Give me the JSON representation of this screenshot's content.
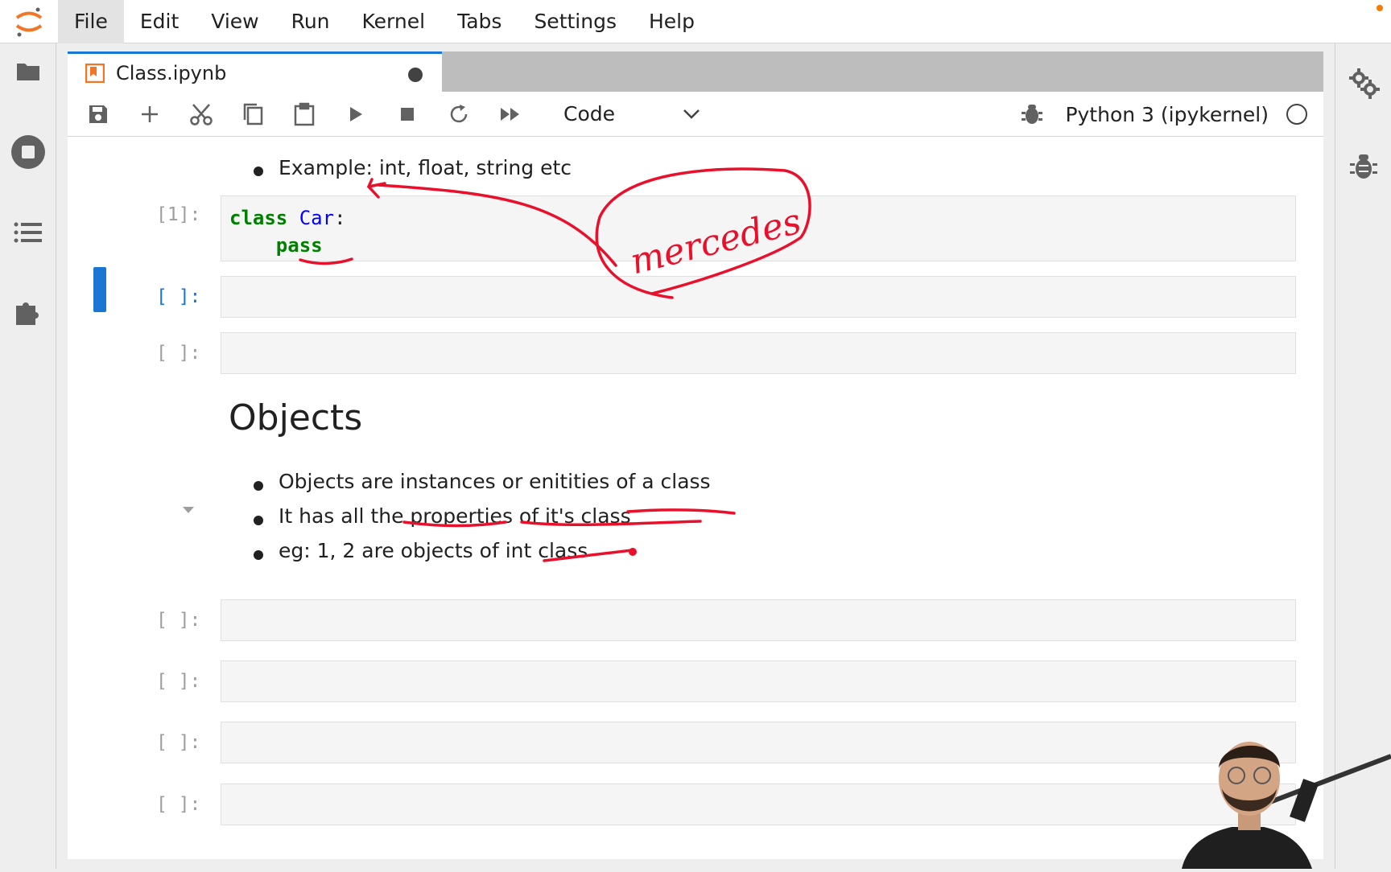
{
  "menubar": {
    "items": [
      "File",
      "Edit",
      "View",
      "Run",
      "Kernel",
      "Tabs",
      "Settings",
      "Help"
    ]
  },
  "tab": {
    "label": "Class.ipynb"
  },
  "toolbar": {
    "cell_type": "Code",
    "kernel_name": "Python 3 (ipykernel)"
  },
  "notebook": {
    "top_bullet": "Example: int, float, string etc",
    "cells": [
      {
        "prompt": "[1]:",
        "code_line1_kw": "class",
        "code_line1_name": "Car",
        "code_line1_colon": ":",
        "code_line2_kw": "pass"
      },
      {
        "prompt": "[ ]:"
      },
      {
        "prompt": "[ ]:"
      },
      {
        "prompt": "[ ]:"
      },
      {
        "prompt": "[ ]:"
      },
      {
        "prompt": "[ ]:"
      },
      {
        "prompt": "[ ]:"
      }
    ],
    "heading": "Objects",
    "bullets": [
      "Objects are instances or enitities of a class",
      "It has all the properties of it's class",
      "eg: 1, 2 are objects of int class"
    ]
  },
  "annotation": {
    "handwritten": "mercedes",
    "ink_color": "#e8102a"
  },
  "colors": {
    "accent": "#1976d2",
    "keyword": "#008000",
    "class_name": "#0000ff",
    "jupyter_orange": "#f37626"
  }
}
